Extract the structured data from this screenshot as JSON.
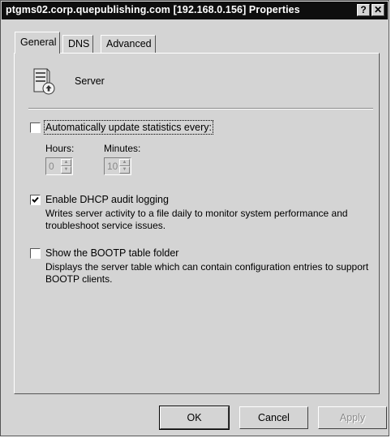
{
  "window": {
    "title": "ptgms02.corp.quepublishing.com [192.168.0.156] Properties",
    "help_button": "?",
    "close_button": "✕"
  },
  "tabs": [
    {
      "label": "General",
      "active": true
    },
    {
      "label": "DNS",
      "active": false
    },
    {
      "label": "Advanced",
      "active": false
    }
  ],
  "general": {
    "server_label": "Server",
    "auto_update": {
      "label": "Automatically update statistics every:",
      "checked": false,
      "hours_label": "Hours:",
      "hours_value": "0",
      "minutes_label": "Minutes:",
      "minutes_value": "10"
    },
    "dhcp_audit": {
      "label": "Enable DHCP audit logging",
      "checked": true,
      "description": "Writes server activity to a file daily to monitor system performance and troubleshoot service issues."
    },
    "bootp": {
      "label": "Show the BOOTP table folder",
      "checked": false,
      "description": "Displays the server table which can contain configuration entries to support BOOTP clients."
    }
  },
  "buttons": {
    "ok": "OK",
    "cancel": "Cancel",
    "apply": "Apply"
  }
}
